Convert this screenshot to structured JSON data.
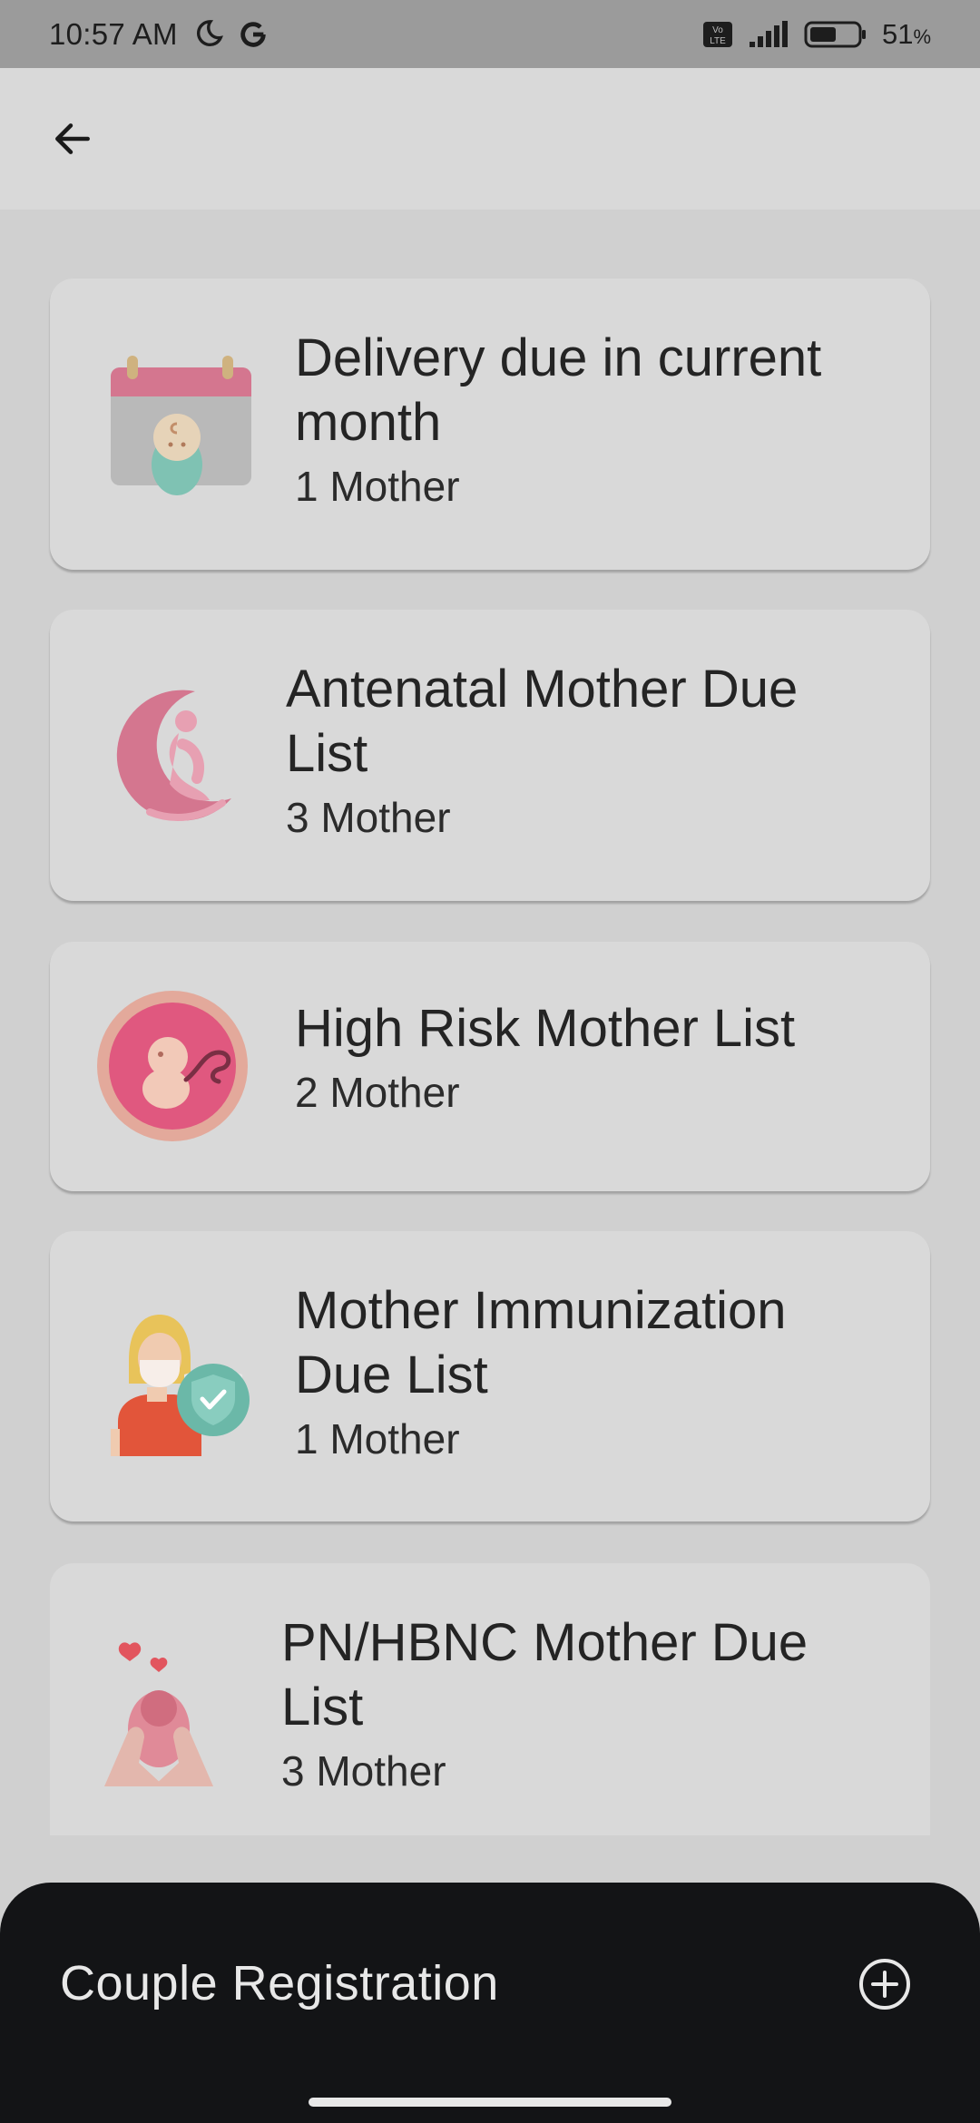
{
  "status_bar": {
    "time": "10:57 AM",
    "volte_label": "Vo LTE",
    "battery_percent": "51",
    "battery_unit": "%",
    "icons": [
      "moon-icon",
      "google-icon",
      "volte-icon",
      "signal-icon",
      "battery-icon"
    ]
  },
  "app_bar": {
    "back_icon": "arrow-left-icon"
  },
  "cards": [
    {
      "title": "Delivery due in current month",
      "count": "1 Mother",
      "icon": "calendar-baby-icon"
    },
    {
      "title": "Antenatal Mother Due List",
      "count": "3 Mother",
      "icon": "pregnant-woman-moon-icon"
    },
    {
      "title": "High Risk Mother List",
      "count": "2 Mother",
      "icon": "fetus-icon"
    },
    {
      "title": "Mother Immunization Due List",
      "count": "1 Mother",
      "icon": "masked-woman-shield-icon"
    },
    {
      "title": "PN/HBNC Mother Due List",
      "count": "3 Mother",
      "icon": "hands-baby-hearts-icon"
    }
  ],
  "bottom_sheet": {
    "label": "Couple Registration",
    "add_icon": "plus-circle-icon"
  },
  "colors": {
    "scrim": "#d0d0d0",
    "card": "#d9d9d9",
    "sheet": "#131416",
    "pink": "#d4768f"
  }
}
